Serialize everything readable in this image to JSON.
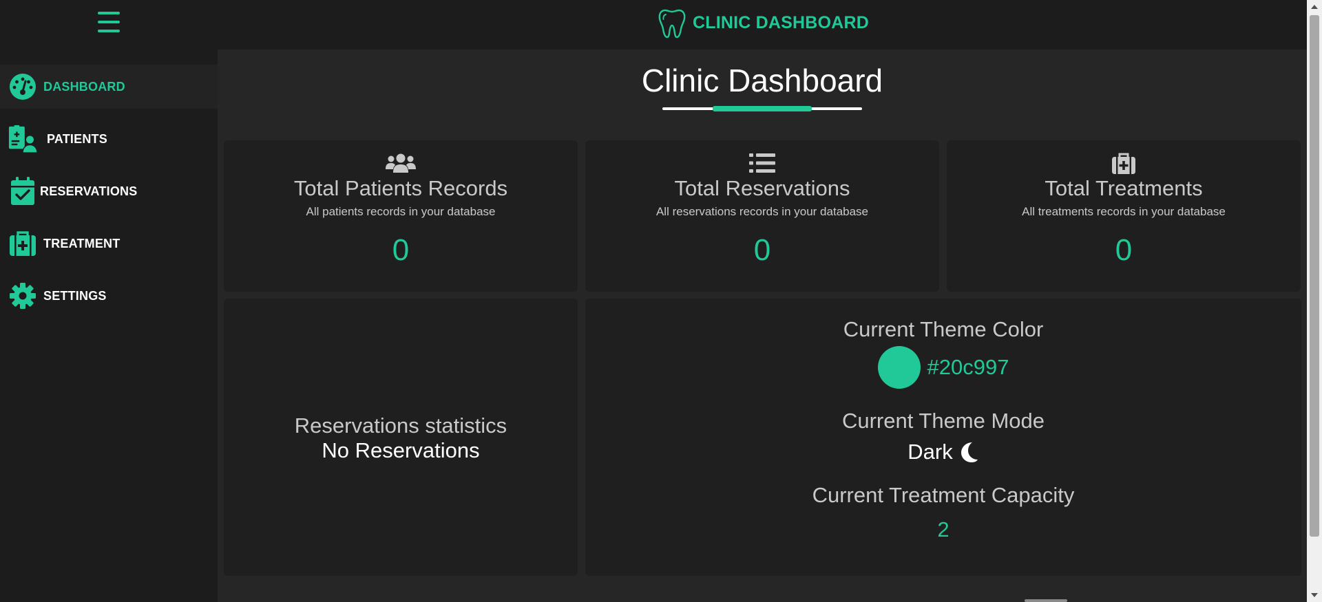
{
  "app": {
    "brand": "CLINIC DASHBOARD",
    "accent_color": "#20c997"
  },
  "sidebar": {
    "items": [
      {
        "label": "DASHBOARD",
        "icon": "gauge-icon",
        "active": true
      },
      {
        "label": "PATIENTS",
        "icon": "patient-records-icon",
        "active": false
      },
      {
        "label": "RESERVATIONS",
        "icon": "calendar-check-icon",
        "active": false
      },
      {
        "label": "TREATMENT",
        "icon": "medkit-icon",
        "active": false
      },
      {
        "label": "SETTINGS",
        "icon": "gear-icon",
        "active": false
      }
    ]
  },
  "main": {
    "title": "Clinic Dashboard",
    "stats": [
      {
        "icon": "users-icon",
        "title": "Total Patients Records",
        "subtitle": "All patients records in your database",
        "value": "0"
      },
      {
        "icon": "list-icon",
        "title": "Total Reservations",
        "subtitle": "All reservations records in your database",
        "value": "0"
      },
      {
        "icon": "medkit-icon",
        "title": "Total Treatments",
        "subtitle": "All treatments records in your database",
        "value": "0"
      }
    ],
    "reservations": {
      "title": "Reservations statistics",
      "empty_text": "No Reservations"
    },
    "theme": {
      "color_label": "Current Theme Color",
      "color_value": "#20c997",
      "mode_label": "Current Theme Mode",
      "mode_value": "Dark",
      "mode_icon": "moon-icon",
      "capacity_label": "Current Treatment Capacity",
      "capacity_value": "2"
    }
  }
}
